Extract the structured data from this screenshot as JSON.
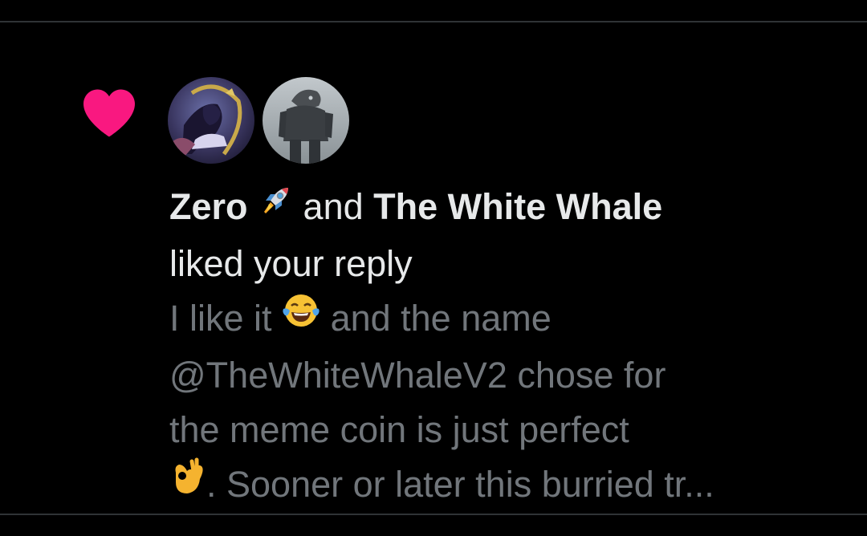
{
  "notification": {
    "type_icon": "heart-icon",
    "accent_color": "#f91880",
    "users": [
      {
        "name": "Zero",
        "emoji": "rocket-emoji",
        "avatar": "anime-character-avatar"
      },
      {
        "name": "The White Whale",
        "avatar": "armored-figure-avatar"
      }
    ],
    "connector": "and",
    "action_text": "liked your reply",
    "reply_lines": [
      {
        "pre": "I like it",
        "emoji": "tears-of-joy-emoji",
        "post": "and the name"
      },
      {
        "text": "@TheWhiteWhaleV2  chose for"
      },
      {
        "text": "the meme coin is just perfect"
      },
      {
        "emoji": "ok-hand-emoji",
        "text": ". Sooner or later this burried tr..."
      }
    ]
  }
}
